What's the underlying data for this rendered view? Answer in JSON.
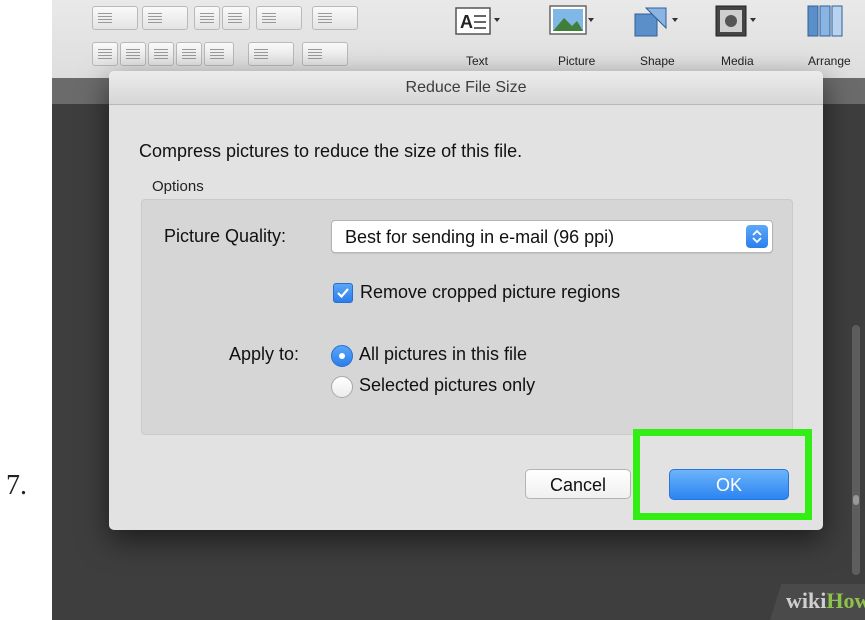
{
  "step_number": "7.",
  "ribbon": {
    "items": [
      {
        "label": "Text",
        "icon": "text-box-icon"
      },
      {
        "label": "Picture",
        "icon": "picture-icon"
      },
      {
        "label": "Shape",
        "icon": "shape-icon"
      },
      {
        "label": "Media",
        "icon": "media-icon"
      },
      {
        "label": "Arrange",
        "icon": "arrange-icon"
      }
    ]
  },
  "dialog": {
    "title": "Reduce File Size",
    "description": "Compress pictures to reduce the size of this file.",
    "options_label": "Options",
    "picture_quality": {
      "label": "Picture Quality:",
      "selected": "Best for sending in e-mail (96 ppi)"
    },
    "remove_cropped": {
      "label": "Remove cropped picture regions",
      "checked": true
    },
    "apply_to": {
      "label": "Apply to:",
      "options": [
        {
          "label": "All pictures in this file",
          "selected": true
        },
        {
          "label": "Selected pictures only",
          "selected": false
        }
      ]
    },
    "cancel_label": "Cancel",
    "ok_label": "OK"
  },
  "highlight_color": "#33ee14",
  "accent_color": "#2b84f2",
  "watermark": {
    "part1": "wiki",
    "part2": "How"
  }
}
